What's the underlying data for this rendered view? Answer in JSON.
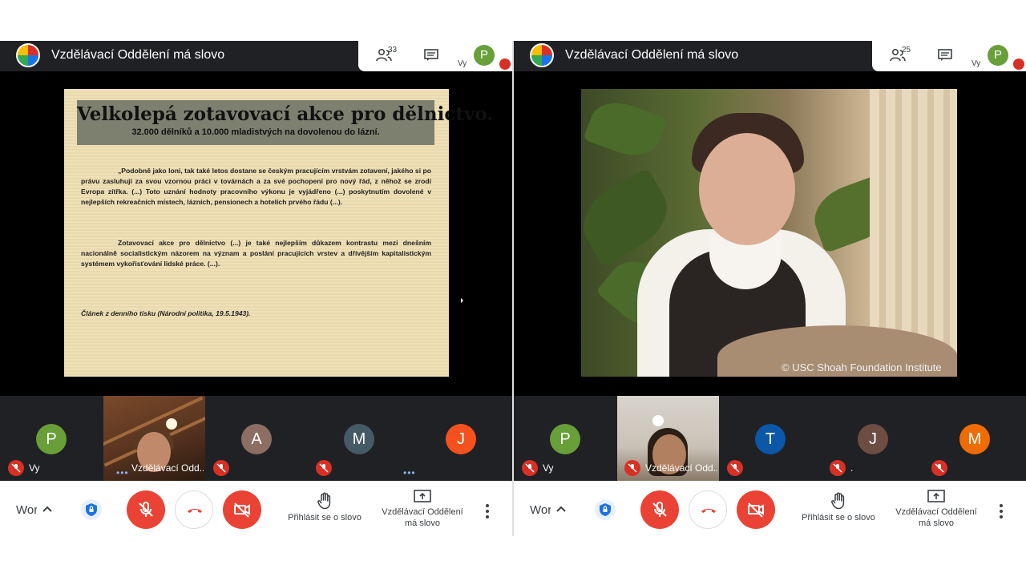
{
  "meeting": {
    "title": "Vzdělávací Oddělení má slovo",
    "self_label": "Vy",
    "meeting_code_truncated": "Wor"
  },
  "colors": {
    "dark_bg": "#202124",
    "mic_off_red": "#d93025",
    "button_red": "#ea4335",
    "avatar_green": "#689f38"
  },
  "panels": [
    {
      "participants_count": "33",
      "self_avatar_letter": "P",
      "slide": {
        "headline": "Velkolepá zotavovací akce pro dělnictvo.",
        "subheadline": "32.000 dělníků a 10.000 mladistvých na dovolenou do lázní.",
        "paragraph1": "„Podobně jako loni, tak také letos dostane se českým pracujícím vrstvám zotavení, jakého si po právu zasluhují za svou vzornou práci v továrnách a za své pochopení pro nový řád, z něhož se zrodí Evropa zítřka. (...) Toto uznání hodnoty pracovního výkonu je vyjádřeno (...) poskytnutím dovolené v nejlepších rekreačních místech, lázních, pensionech a hotelích prvého řádu (...).",
        "paragraph2": "Zotavovací akce pro dělnictvo (...) je také nejlepším důkazem kontrastu mezi dnešním nacionálně socialistickým názorem na význam a poslání pracujících vrstev a dřívějším kapitalistickým systémem vykořisťování lidské práce. (...).",
        "source": "Článek z denního tisku (Národní politika, 19.5.1943)."
      },
      "tiles": [
        {
          "kind": "avatar",
          "letter": "P",
          "color": "#689f38",
          "name": "Vy",
          "muted": true
        },
        {
          "kind": "camera",
          "name": "Vzdělávací Odd...",
          "muted": false,
          "speaking": true
        },
        {
          "kind": "avatar",
          "letter": "A",
          "color": "#8d6e63",
          "name": "",
          "muted": true
        },
        {
          "kind": "avatar",
          "letter": "M",
          "color": "#455a64",
          "name": "",
          "muted": true
        },
        {
          "kind": "avatar",
          "letter": "J",
          "color": "#f4511e",
          "name": "",
          "muted": false,
          "speaking": true
        }
      ],
      "controls": {
        "raise_hand": "Přihlásit se o slovo",
        "presenting": "Vzdělávací Oddělení má slovo"
      }
    },
    {
      "participants_count": "25",
      "self_avatar_letter": "P",
      "video": {
        "watermark": "© USC Shoah Foundation Institute"
      },
      "tiles": [
        {
          "kind": "avatar",
          "letter": "P",
          "color": "#689f38",
          "name": "Vy",
          "muted": true
        },
        {
          "kind": "camera",
          "name": "Vzdělávací Odd...",
          "muted": true
        },
        {
          "kind": "avatar",
          "letter": "T",
          "color": "#0b57a8",
          "name": "",
          "muted": true
        },
        {
          "kind": "avatar",
          "letter": "J",
          "color": "#6d4c41",
          "name": ".",
          "muted": true
        },
        {
          "kind": "avatar",
          "letter": "M",
          "color": "#ef6c00",
          "name": "",
          "muted": true
        }
      ],
      "controls": {
        "raise_hand": "Přihlásit se o slovo",
        "presenting": "Vzdělávací Oddělení má slovo"
      }
    }
  ]
}
